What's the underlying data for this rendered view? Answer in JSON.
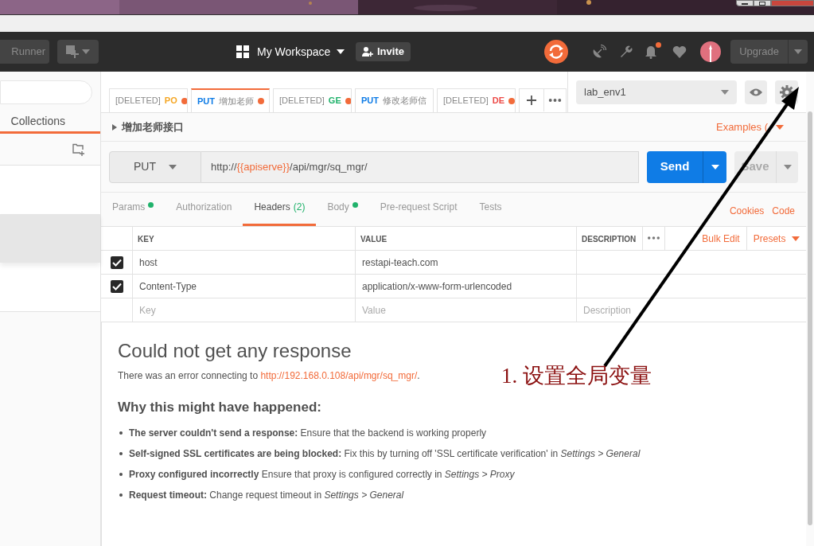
{
  "header": {
    "runner": "Runner",
    "workspace": "My Workspace",
    "invite": "Invite",
    "has_notification": true,
    "upgrade": "Upgrade"
  },
  "sidebar": {
    "tabs": [
      {
        "label": "Collections",
        "selected": true
      }
    ],
    "rows": [
      {
        "selected": false
      },
      {
        "selected": true
      },
      {
        "selected": false
      }
    ]
  },
  "tabs": [
    {
      "prefix": "[DELETED]",
      "method": "PO",
      "color": "#f5a623",
      "unsaved": true,
      "selected": false
    },
    {
      "method": "PUT",
      "color": "#0f7ce6",
      "title": "增加老师",
      "unsaved": true,
      "selected": true
    },
    {
      "prefix": "[DELETED]",
      "method": "GE",
      "color": "#20b26b",
      "unsaved": true,
      "selected": false
    },
    {
      "method": "PUT",
      "color": "#0f7ce6",
      "title": "修改老师信",
      "unsaved": false,
      "selected": false
    },
    {
      "prefix": "[DELETED]",
      "method": "DE",
      "color": "#ed4b48",
      "unsaved": true,
      "selected": false
    }
  ],
  "environment": {
    "value": "lab_env1"
  },
  "request": {
    "name": "增加老师接口",
    "examples": "Examples (",
    "method": "PUT",
    "url": [
      {
        "kind": "plain",
        "text": "http://"
      },
      {
        "kind": "variable",
        "text": "{{apiserve}}"
      },
      {
        "kind": "plain",
        "text": "/api/mgr/sq_mgr/"
      }
    ],
    "send": "Send",
    "save": "Save"
  },
  "request_tabs": [
    {
      "label": "Params",
      "has_dot": true,
      "selected": false
    },
    {
      "label": "Authorization",
      "has_dot": false,
      "selected": false
    },
    {
      "label": "Headers",
      "count": "(2)",
      "has_dot": false,
      "selected": true
    },
    {
      "label": "Body",
      "has_dot": true,
      "selected": false
    },
    {
      "label": "Pre-request Script",
      "has_dot": false,
      "selected": false
    },
    {
      "label": "Tests",
      "has_dot": false,
      "selected": false
    }
  ],
  "links": [
    "Cookies",
    "Code"
  ],
  "headers_table": {
    "columns": [
      "KEY",
      "VALUE",
      "DESCRIPTION"
    ],
    "actions": [
      "Bulk Edit",
      "Presets"
    ],
    "rows": [
      {
        "checked": true,
        "key": "host",
        "value": "restapi-teach.com"
      },
      {
        "checked": true,
        "key": "Content-Type",
        "value": "application/x-www-form-urlencoded"
      }
    ],
    "new_row": [
      {
        "placeholder": "Key"
      },
      {
        "placeholder": "Value"
      },
      {
        "placeholder": "Description"
      }
    ]
  },
  "response": {
    "title": "Could not get any response",
    "message": "There was an error connecting to ",
    "link": "http://192.168.0.108/api/mgr/sq_mgr/",
    "message_end": ".",
    "subtitle": "Why this might have happened:",
    "reasons": [
      "**The server couldn't send a response:** Ensure that the backend is working properly",
      "**Self-signed SSL certificates are being blocked:** Fix this by turning off 'SSL certificate verification' in *Settings > General*",
      "**Proxy configured incorrectly** Ensure that proxy is configured correctly in *Settings > Proxy*",
      "**Request timeout:** Change request timeout in *Settings > General*"
    ]
  },
  "annotation": {
    "text": "1. 设置全局变量"
  }
}
